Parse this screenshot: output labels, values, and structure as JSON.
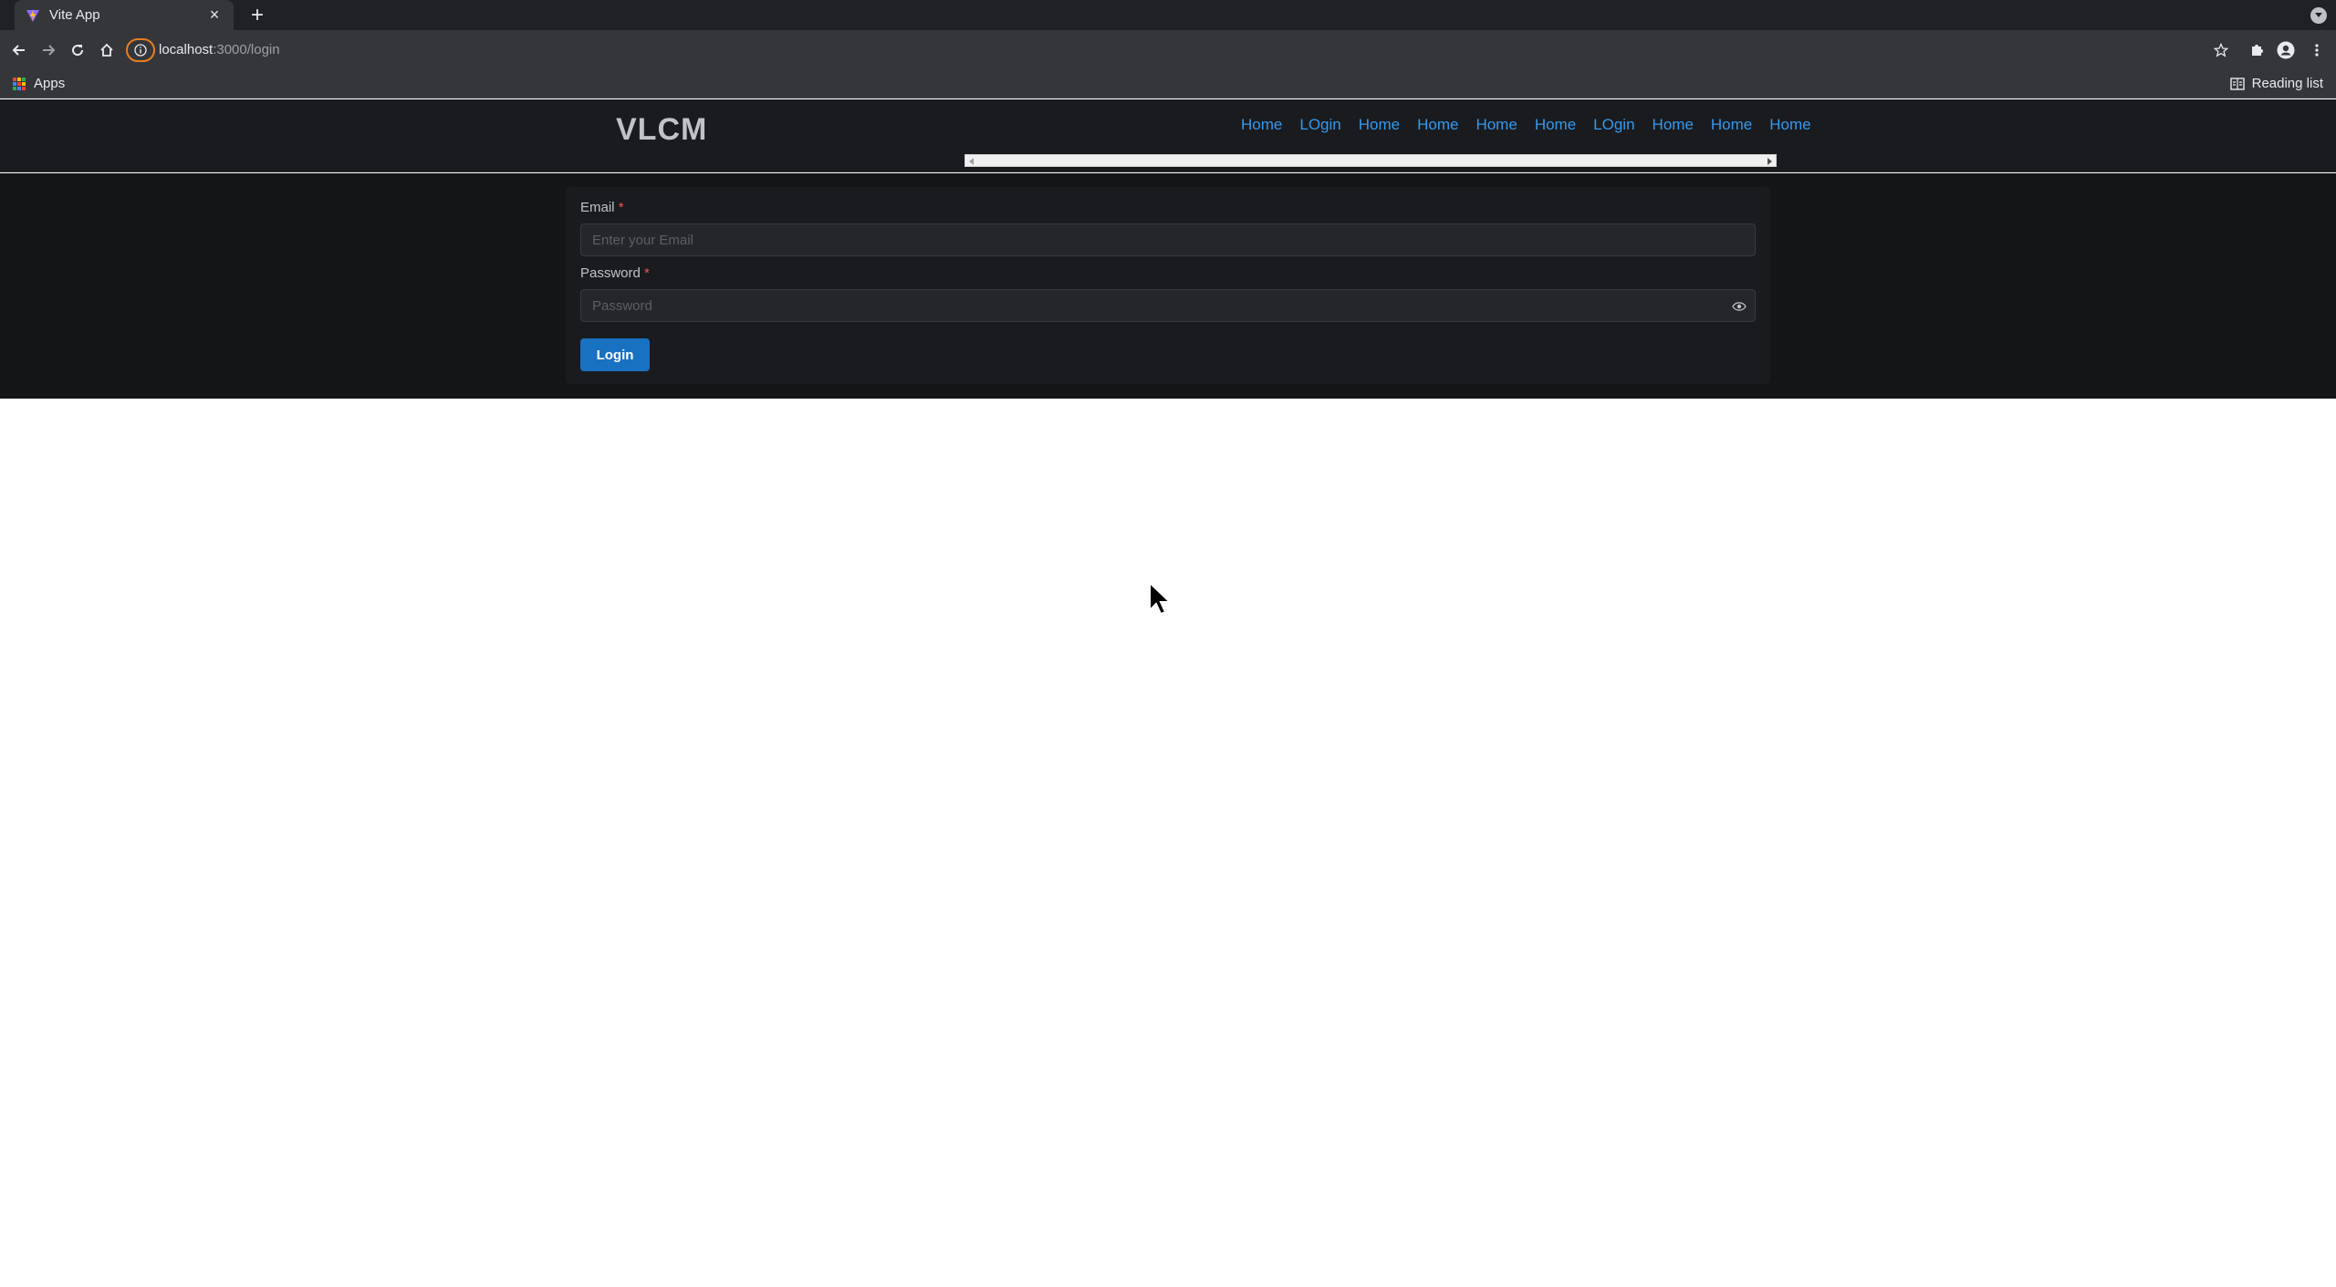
{
  "browser": {
    "tab_title": "Vite App",
    "url_host": "localhost",
    "url_path": ":3000/login",
    "bookmarks": {
      "apps_label": "Apps",
      "reading_list_label": "Reading list"
    },
    "colors": {
      "frame": "#202124",
      "toolbar": "#35363a",
      "site_info_ring": "#e67e22"
    }
  },
  "app": {
    "logo": "VLCM",
    "nav": [
      "Home",
      "LOgin",
      "Home",
      "Home",
      "Home",
      "Home",
      "LOgin",
      "Home",
      "Home",
      "Home"
    ],
    "colors": {
      "accent": "#1971c2",
      "link": "#339af0",
      "required": "#fa5252"
    }
  },
  "login_form": {
    "email_label": "Email",
    "email_placeholder": "Enter your Email",
    "password_label": "Password",
    "password_placeholder": "Password",
    "required_mark": "*",
    "submit_label": "Login"
  }
}
